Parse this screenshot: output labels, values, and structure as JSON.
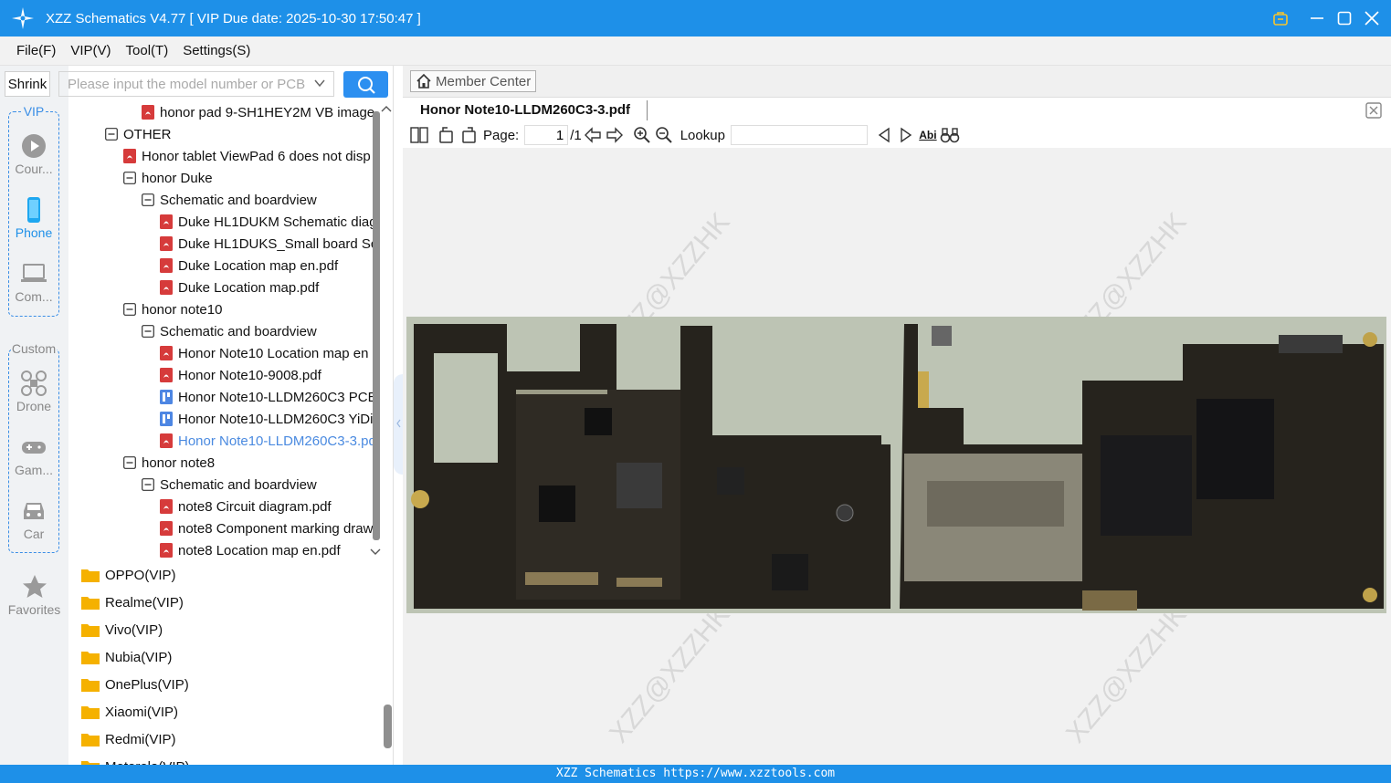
{
  "titlebar": {
    "title": "XZZ Schematics V4.77 [ VIP Due date: 2025-10-30 17:50:47 ]",
    "accent": "#1e90e8",
    "vip_icon": "lock-bag-icon"
  },
  "menu": [
    "File(F)",
    "VIP(V)",
    "Tool(T)",
    "Settings(S)"
  ],
  "toolbar": {
    "shrink_label": "Shrink",
    "search_placeholder": "Please input the model number or PCB"
  },
  "rail": {
    "vip_group_label": "VIP",
    "vip_items": [
      {
        "label": "Cour...",
        "icon": "play-circle-icon"
      },
      {
        "label": "Phone",
        "icon": "phone-icon"
      },
      {
        "label": "Com...",
        "icon": "laptop-icon"
      }
    ],
    "custom_group_label": "Custom",
    "custom_items": [
      {
        "label": "Drone",
        "icon": "drone-icon"
      },
      {
        "label": "Gam...",
        "icon": "gamepad-icon"
      },
      {
        "label": "Car",
        "icon": "car-icon"
      }
    ],
    "favorites_label": "Favorites"
  },
  "tree": {
    "nodes": [
      {
        "label": "honor pad 9-SH1HEY2M VB image",
        "type": "pdf"
      },
      {
        "label": "OTHER",
        "type": "folder"
      },
      {
        "label": "Honor tablet ViewPad 6 does not disp",
        "type": "pdf"
      },
      {
        "label": "honor Duke",
        "type": "folder"
      },
      {
        "label": "Schematic and boardview",
        "type": "folder"
      },
      {
        "label": "Duke HL1DUKM Schematic diag",
        "type": "pdf"
      },
      {
        "label": "Duke HL1DUKS_Small board Sc",
        "type": "pdf"
      },
      {
        "label": "Duke Location map en.pdf",
        "type": "pdf"
      },
      {
        "label": "Duke Location map.pdf",
        "type": "pdf"
      },
      {
        "label": "honor note10",
        "type": "folder"
      },
      {
        "label": "Schematic and boardview",
        "type": "folder"
      },
      {
        "label": "Honor Note10 Location map en",
        "type": "pdf"
      },
      {
        "label": "Honor Note10-9008.pdf",
        "type": "pdf"
      },
      {
        "label": "Honor Note10-LLDM260C3 PCB",
        "type": "pcb"
      },
      {
        "label": "Honor Note10-LLDM260C3 YiDi",
        "type": "pcb"
      },
      {
        "label": "Honor Note10-LLDM260C3-3.pd",
        "type": "pdf-selected"
      },
      {
        "label": "honor note8",
        "type": "folder"
      },
      {
        "label": "Schematic and boardview",
        "type": "folder"
      },
      {
        "label": "note8 Circuit diagram.pdf",
        "type": "pdf"
      },
      {
        "label": "note8 Component marking draw",
        "type": "pdf"
      },
      {
        "label": "note8 Location map en.pdf",
        "type": "pdf"
      }
    ],
    "brands": [
      "OPPO(VIP)",
      "Realme(VIP)",
      "Vivo(VIP)",
      "Nubia(VIP)",
      "OnePlus(VIP)",
      "Xiaomi(VIP)",
      "Redmi(VIP)",
      "Motorola(VIP)"
    ]
  },
  "content": {
    "member_center": "Member Center",
    "doc_tab": "Honor Note10-LLDM260C3-3.pdf",
    "page_label": "Page:",
    "page_value": "1",
    "page_total": "/1",
    "lookup_label": "Lookup",
    "watermark": "XZZ@XZZHK"
  },
  "statusbar": {
    "text": "XZZ Schematics https://www.xzztools.com"
  }
}
